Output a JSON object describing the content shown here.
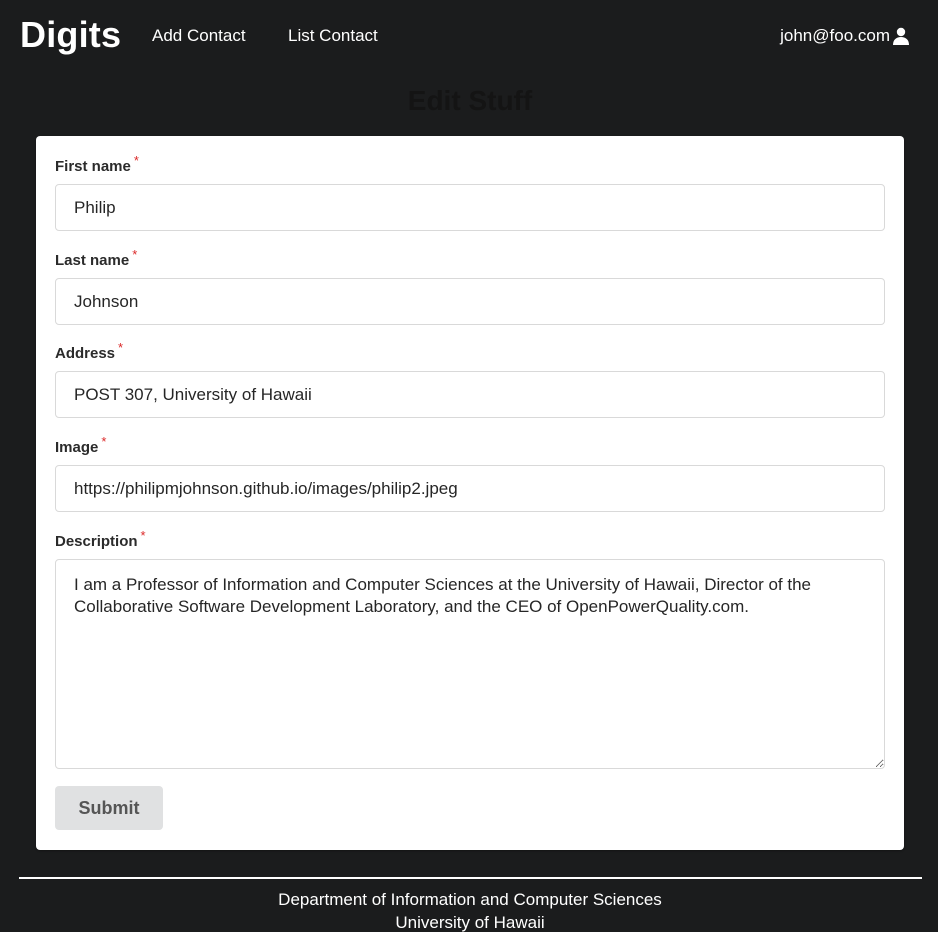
{
  "navbar": {
    "brand": "Digits",
    "links": [
      {
        "label": "Add Contact"
      },
      {
        "label": "List Contact"
      }
    ],
    "user": {
      "email": "john@foo.com",
      "icon": "user-icon"
    }
  },
  "page": {
    "title": "Edit Stuff"
  },
  "form": {
    "required_marker": "*",
    "fields": {
      "first_name": {
        "label": "First name",
        "value": "Philip"
      },
      "last_name": {
        "label": "Last name",
        "value": "Johnson"
      },
      "address": {
        "label": "Address",
        "value": "POST 307, University of Hawaii"
      },
      "image": {
        "label": "Image",
        "value": "https://philipmjohnson.github.io/images/philip2.jpeg"
      },
      "description": {
        "label": "Description",
        "value": "I am a Professor of Information and Computer Sciences at the University of Hawaii, Director of the Collaborative Software Development Laboratory, and the CEO of OpenPowerQuality.com."
      }
    },
    "submit_label": "Submit"
  },
  "footer": {
    "line1": "Department of Information and Computer Sciences",
    "line2": "University of Hawaii"
  },
  "colors": {
    "background": "#1b1c1d",
    "required": "#db2828",
    "submit_bg": "#e0e1e2"
  }
}
